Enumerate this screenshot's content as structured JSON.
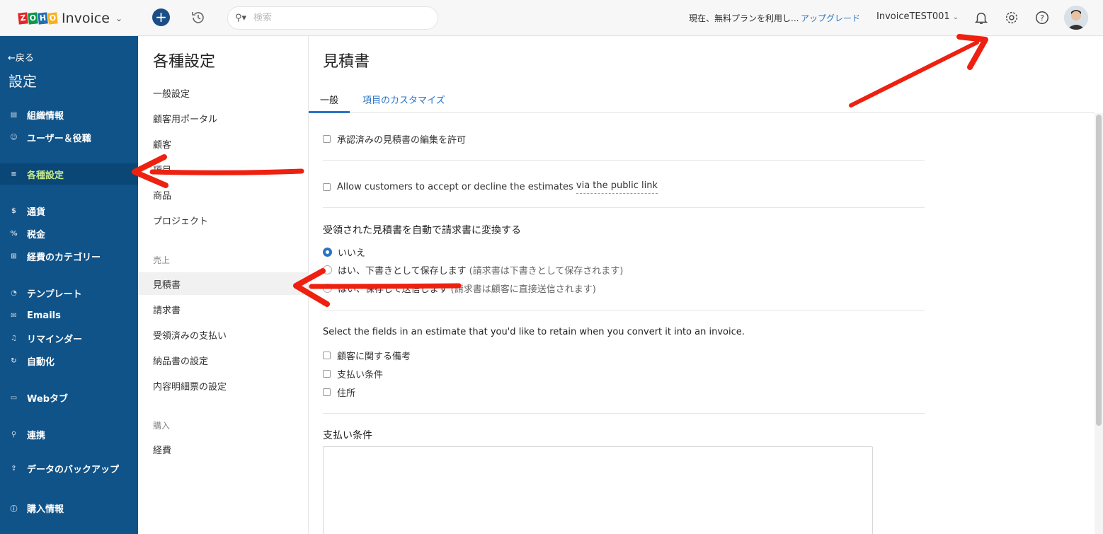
{
  "brand": {
    "logo_letters": [
      "Z",
      "O",
      "H",
      "O"
    ],
    "logo_colors": [
      "#e42527",
      "#089949",
      "#226db4",
      "#f9b21d"
    ],
    "name": "Invoice"
  },
  "topbar": {
    "search_placeholder": "検索",
    "plan_text": "現在、無料プランを利用し...",
    "upgrade_label": "アップグレード",
    "org_name": "InvoiceTEST001",
    "icons": [
      "plus-icon",
      "history-icon",
      "search-icon",
      "bell-icon",
      "gear-icon",
      "help-icon",
      "avatar"
    ]
  },
  "sidebar": {
    "back_label": "←戻る",
    "title": "設定",
    "items": [
      {
        "label": "組織情報",
        "icon": "building-icon"
      },
      {
        "label": "ユーザー＆役職",
        "icon": "users-icon"
      },
      {
        "label": "各種設定",
        "icon": "sliders-icon",
        "active": true
      },
      {
        "label": "通貨",
        "icon": "currency-icon"
      },
      {
        "label": "税金",
        "icon": "percent-icon"
      },
      {
        "label": "経費のカテゴリー",
        "icon": "category-icon"
      },
      {
        "label": "テンプレート",
        "icon": "palette-icon"
      },
      {
        "label": "Emails",
        "icon": "mail-icon"
      },
      {
        "label": "リマインダー",
        "icon": "bell-icon"
      },
      {
        "label": "自動化",
        "icon": "sync-icon"
      },
      {
        "label": "Webタブ",
        "icon": "tab-icon"
      },
      {
        "label": "連携",
        "icon": "plug-icon"
      },
      {
        "label": "データのバックアップ",
        "icon": "backup-icon"
      },
      {
        "label": "購入情報",
        "icon": "info-icon"
      }
    ]
  },
  "prefs": {
    "title": "各種設定",
    "general_items": [
      "一般設定",
      "顧客用ポータル",
      "顧客",
      "項目",
      "商品",
      "プロジェクト"
    ],
    "sales_heading": "売上",
    "sales_items": [
      "見積書",
      "請求書",
      "受領済みの支払い",
      "納品書の設定",
      "内容明細票の設定"
    ],
    "purchase_heading": "購入",
    "purchase_items": [
      "経費"
    ]
  },
  "main": {
    "title": "見積書",
    "tabs": [
      "一般",
      "項目のカスタマイズ"
    ],
    "allow_edit_label": "承認済みの見積書の編集を許可",
    "allow_customers_label": "Allow customers to accept or decline the estimates",
    "allow_customers_link": "via the public link",
    "convert_title": "受領された見積書を自動で請求書に変換する",
    "radio_options": [
      {
        "label": "いいえ",
        "hint": "",
        "checked": true
      },
      {
        "label": "はい、下書きとして保存します",
        "hint": "(請求書は下書きとして保存されます)",
        "checked": false
      },
      {
        "label": "はい、保存して送信します",
        "hint": "(請求書は顧客に直接送信されます)",
        "checked": false
      }
    ],
    "fields_title": "Select the fields in an estimate that you'd like to retain when you convert it into an invoice.",
    "fields": [
      "顧客に関する備考",
      "支払い条件",
      "住所"
    ],
    "payment_terms_label": "支払い条件",
    "payment_terms_value": ""
  },
  "annotation_color": "#ee2010"
}
